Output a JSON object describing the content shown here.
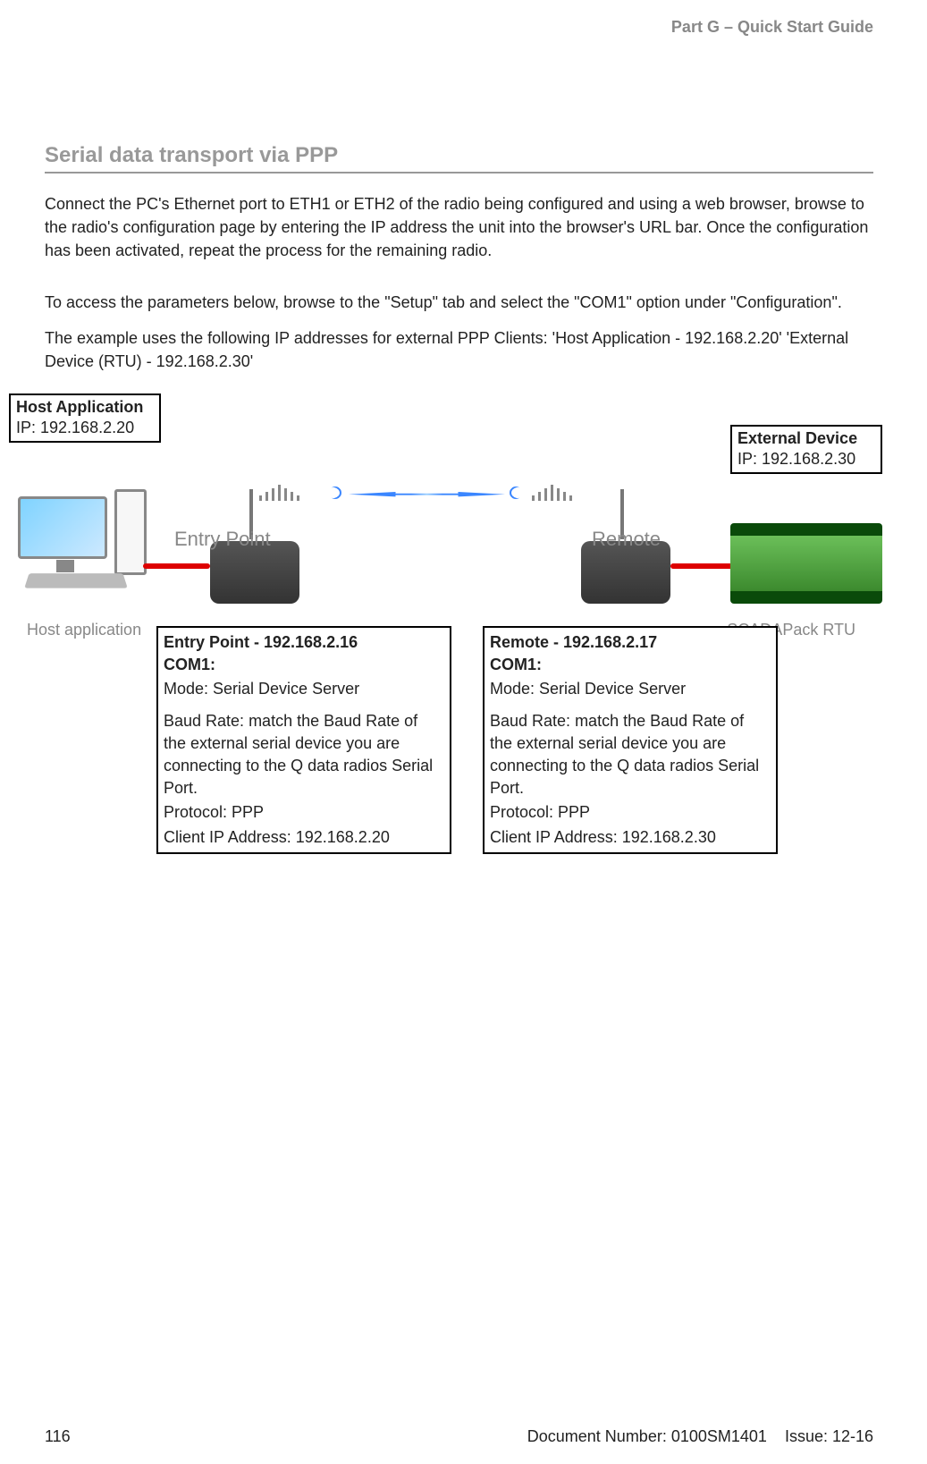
{
  "header": {
    "part": "Part G – Quick Start Guide"
  },
  "section_title": "Serial data transport via PPP",
  "paragraphs": {
    "p1": "Connect the PC's Ethernet port to ETH1 or ETH2 of the radio being configured and using a web browser, browse to the radio's configuration page by entering the IP address the unit into the browser's URL bar.  Once the configuration has been activated, repeat the process for the remaining radio.",
    "p2": "To access the parameters below, browse to the \"Setup\" tab and select the \"COM1\" option under \"Configuration\".",
    "p3": "The example uses the following IP addresses for external PPP Clients: 'Host Application - 192.168.2.20' 'External Device (RTU) - 192.168.2.30'"
  },
  "diagram": {
    "host_label_title": "Host Application",
    "host_label_ip": "IP: 192.168.2.20",
    "ext_label_title": "External Device",
    "ext_label_ip": "IP: 192.168.2.30",
    "host_caption": "Host application",
    "rtu_caption": "SCADAPack RTU",
    "entry_label": "Entry Point",
    "remote_label": "Remote"
  },
  "entry_box": {
    "title": "Entry Point - 192.168.2.16",
    "com": "COM1:",
    "mode": "Mode: Serial Device Server",
    "baud": "Baud Rate: match the Baud Rate of the external serial device you are connecting to the Q data radios Serial Port.",
    "proto": "Protocol: PPP",
    "client": "Client IP Address: 192.168.2.20"
  },
  "remote_box": {
    "title": "Remote - 192.168.2.17",
    "com": "COM1:",
    "mode": "Mode: Serial Device Server",
    "baud": "Baud Rate: match the Baud Rate of the external serial device you are connecting to the Q data radios Serial Port.",
    "proto": "Protocol: PPP",
    "client": "Client IP Address: 192.168.2.30"
  },
  "footer": {
    "page": "116",
    "docnum": "Document Number: 0100SM1401",
    "issue": "Issue: 12-16"
  }
}
